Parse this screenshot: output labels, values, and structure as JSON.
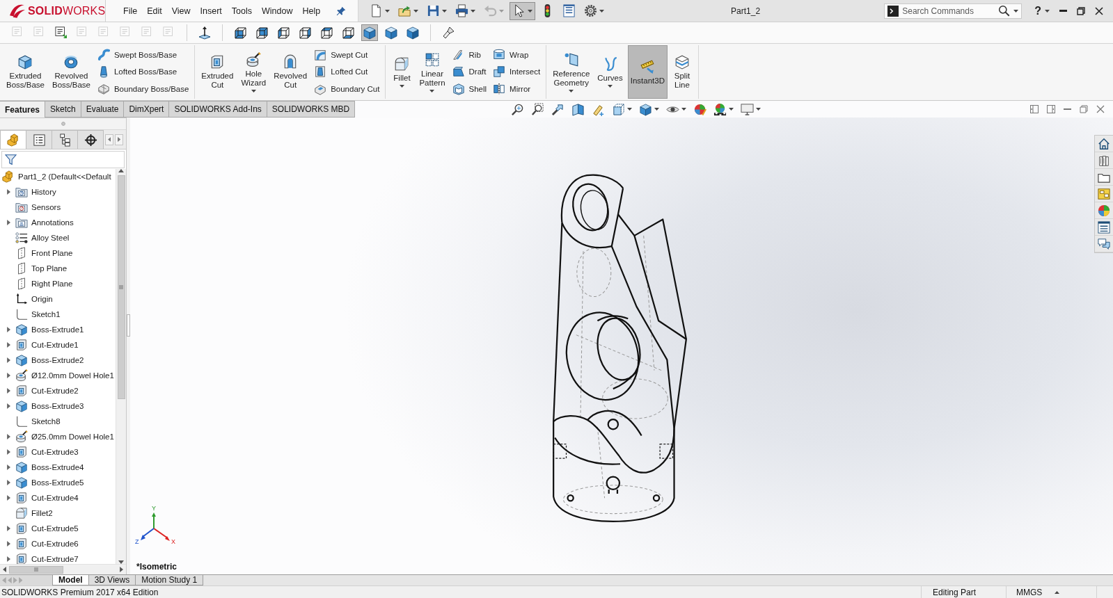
{
  "app": {
    "logo": "**SOLID**WORKS",
    "title": "Part1_2",
    "help": "?"
  },
  "menu": [
    "File",
    "Edit",
    "View",
    "Insert",
    "Tools",
    "Window",
    "Help"
  ],
  "quick_access": [
    {
      "kind": "new",
      "dropdown": true,
      "disabled": false,
      "selected": false
    },
    {
      "kind": "open",
      "dropdown": true,
      "disabled": false,
      "selected": false
    },
    {
      "kind": "save",
      "dropdown": true,
      "disabled": false,
      "selected": false
    },
    {
      "kind": "print",
      "dropdown": true,
      "disabled": false,
      "selected": false
    },
    {
      "kind": "undo",
      "dropdown": true,
      "disabled": true,
      "selected": false
    },
    {
      "kind": "select",
      "dropdown": true,
      "disabled": false,
      "selected": true
    },
    {
      "kind": "rebuild",
      "dropdown": false,
      "disabled": false,
      "selected": false
    },
    {
      "kind": "properties",
      "dropdown": false,
      "disabled": false,
      "selected": false
    },
    {
      "kind": "options",
      "dropdown": true,
      "disabled": false,
      "selected": false
    }
  ],
  "search": {
    "placeholder": "Search Commands"
  },
  "annotation_tools": [
    {
      "disabled": true
    },
    {
      "disabled": true
    },
    {
      "disabled": false
    },
    {
      "disabled": true
    },
    {
      "disabled": true
    },
    {
      "disabled": true
    },
    {
      "disabled": true
    },
    {
      "disabled": true
    }
  ],
  "view_orientations": [
    {
      "kind": "front",
      "selected": false
    },
    {
      "kind": "back",
      "selected": false
    },
    {
      "kind": "left",
      "selected": false
    },
    {
      "kind": "right",
      "selected": false
    },
    {
      "kind": "top",
      "selected": false
    },
    {
      "kind": "bottom",
      "selected": false
    },
    {
      "kind": "isometric",
      "selected": true
    },
    {
      "kind": "trimetric",
      "selected": false
    },
    {
      "kind": "dimetric",
      "selected": false
    }
  ],
  "ribbon": {
    "groups": [
      {
        "large": [
          {
            "label": "Extruded Boss/Base",
            "kind": "extrude",
            "dropdown": false,
            "selected": false
          },
          {
            "label": "Revolved Boss/Base",
            "kind": "revolve",
            "dropdown": false,
            "selected": false
          }
        ],
        "small_columns": [
          [
            {
              "label": "Swept Boss/Base",
              "kind": "swept"
            },
            {
              "label": "Lofted Boss/Base",
              "kind": "lofted"
            },
            {
              "label": "Boundary Boss/Base",
              "kind": "boundary"
            }
          ]
        ]
      },
      {
        "large": [
          {
            "label": "Extruded Cut",
            "kind": "extrude-cut",
            "dropdown": false,
            "selected": false
          },
          {
            "label": "Hole Wizard",
            "kind": "hole",
            "dropdown": true,
            "selected": false
          },
          {
            "label": "Revolved Cut",
            "kind": "revolve-cut",
            "dropdown": false,
            "selected": false
          }
        ],
        "small_columns": [
          [
            {
              "label": "Swept Cut",
              "kind": "swept-cut"
            },
            {
              "label": "Lofted Cut",
              "kind": "lofted-cut"
            },
            {
              "label": "Boundary Cut",
              "kind": "boundary-cut"
            }
          ]
        ]
      },
      {
        "large": [
          {
            "label": "Fillet",
            "kind": "fillet",
            "dropdown": true,
            "selected": false
          },
          {
            "label": "Linear Pattern",
            "kind": "pattern",
            "dropdown": true,
            "selected": false
          }
        ],
        "small_columns": [
          [
            {
              "label": "Rib",
              "kind": "rib"
            },
            {
              "label": "Draft",
              "kind": "draft"
            },
            {
              "label": "Shell",
              "kind": "shell"
            }
          ],
          [
            {
              "label": "Wrap",
              "kind": "wrap"
            },
            {
              "label": "Intersect",
              "kind": "intersect"
            },
            {
              "label": "Mirror",
              "kind": "mirror"
            }
          ]
        ]
      },
      {
        "large": [
          {
            "label": "Reference Geometry",
            "kind": "reference",
            "dropdown": true,
            "selected": false
          },
          {
            "label": "Curves",
            "kind": "curves",
            "dropdown": true,
            "selected": false
          },
          {
            "label": "Instant3D",
            "kind": "instant3d",
            "dropdown": false,
            "selected": true
          },
          {
            "label": "Split Line",
            "kind": "split-line",
            "dropdown": false,
            "selected": false
          }
        ]
      }
    ]
  },
  "command_tabs": [
    {
      "label": "Features",
      "selected": true
    },
    {
      "label": "Sketch",
      "selected": false
    },
    {
      "label": "Evaluate",
      "selected": false
    },
    {
      "label": "DimXpert",
      "selected": false
    },
    {
      "label": "SOLIDWORKS Add-Ins",
      "selected": false
    },
    {
      "label": "SOLIDWORKS MBD",
      "selected": false
    }
  ],
  "feature_manager": {
    "tabs": [
      {
        "kind": "features",
        "selected": true
      },
      {
        "kind": "properties",
        "selected": false
      },
      {
        "kind": "configurations",
        "selected": false
      },
      {
        "kind": "dimxpert",
        "selected": false
      }
    ],
    "root": {
      "label": "Part1_2 (Default<<Default"
    },
    "items": [
      {
        "label": "History",
        "kind": "history",
        "expandable": true
      },
      {
        "label": "Sensors",
        "kind": "sensors",
        "expandable": false
      },
      {
        "label": "Annotations",
        "kind": "annotations",
        "expandable": true
      },
      {
        "label": "Alloy Steel",
        "kind": "material",
        "expandable": false
      },
      {
        "label": "Front Plane",
        "kind": "plane",
        "expandable": false
      },
      {
        "label": "Top Plane",
        "kind": "plane",
        "expandable": false
      },
      {
        "label": "Right Plane",
        "kind": "plane",
        "expandable": false
      },
      {
        "label": "Origin",
        "kind": "origin",
        "expandable": false
      },
      {
        "label": "Sketch1",
        "kind": "sketch",
        "expandable": false
      },
      {
        "label": "Boss-Extrude1",
        "kind": "boss",
        "expandable": true
      },
      {
        "label": "Cut-Extrude1",
        "kind": "cut",
        "expandable": true
      },
      {
        "label": "Boss-Extrude2",
        "kind": "boss",
        "expandable": true
      },
      {
        "label": "Ø12.0mm Dowel Hole1",
        "kind": "hole",
        "expandable": true
      },
      {
        "label": "Cut-Extrude2",
        "kind": "cut",
        "expandable": true
      },
      {
        "label": "Boss-Extrude3",
        "kind": "boss",
        "expandable": true
      },
      {
        "label": "Sketch8",
        "kind": "sketch",
        "expandable": false
      },
      {
        "label": "Ø25.0mm Dowel Hole1",
        "kind": "hole",
        "expandable": true
      },
      {
        "label": "Cut-Extrude3",
        "kind": "cut",
        "expandable": true
      },
      {
        "label": "Boss-Extrude4",
        "kind": "boss",
        "expandable": true
      },
      {
        "label": "Boss-Extrude5",
        "kind": "boss",
        "expandable": true
      },
      {
        "label": "Cut-Extrude4",
        "kind": "cut",
        "expandable": true
      },
      {
        "label": "Fillet2",
        "kind": "fillet",
        "expandable": false
      },
      {
        "label": "Cut-Extrude5",
        "kind": "cut",
        "expandable": true
      },
      {
        "label": "Cut-Extrude6",
        "kind": "cut",
        "expandable": true
      },
      {
        "label": "Cut-Extrude7",
        "kind": "cut",
        "expandable": true
      }
    ]
  },
  "viewport": {
    "heads_up": [
      {
        "kind": "zoom-fit",
        "dropdown": false
      },
      {
        "kind": "zoom-area",
        "dropdown": false
      },
      {
        "kind": "previous-view",
        "dropdown": false
      },
      {
        "kind": "section-view",
        "dropdown": false
      },
      {
        "kind": "dynamic-annotation",
        "dropdown": false
      },
      {
        "kind": "view-orientation",
        "dropdown": true
      },
      {
        "kind": "display-style",
        "dropdown": true
      },
      {
        "kind": "hide-show",
        "dropdown": true
      },
      {
        "kind": "edit-appearance",
        "dropdown": false
      },
      {
        "kind": "apply-scene",
        "dropdown": true
      },
      {
        "kind": "view-settings",
        "dropdown": true
      }
    ],
    "task_pane": [
      {
        "kind": "home"
      },
      {
        "kind": "parts"
      },
      {
        "kind": "folder"
      },
      {
        "kind": "palette"
      },
      {
        "kind": "appearance"
      },
      {
        "kind": "properties"
      },
      {
        "kind": "forum"
      }
    ],
    "triad": {
      "y": "Y",
      "z": "Z",
      "x": "X"
    },
    "view_name": "*Isometric"
  },
  "bottom_tabs": [
    {
      "label": "Model",
      "selected": true
    },
    {
      "label": "3D Views",
      "selected": false
    },
    {
      "label": "Motion Study 1",
      "selected": false
    }
  ],
  "status_bar": {
    "edition": "SOLIDWORKS Premium 2017 x64 Edition",
    "mode": "Editing Part",
    "units": "MMGS"
  }
}
